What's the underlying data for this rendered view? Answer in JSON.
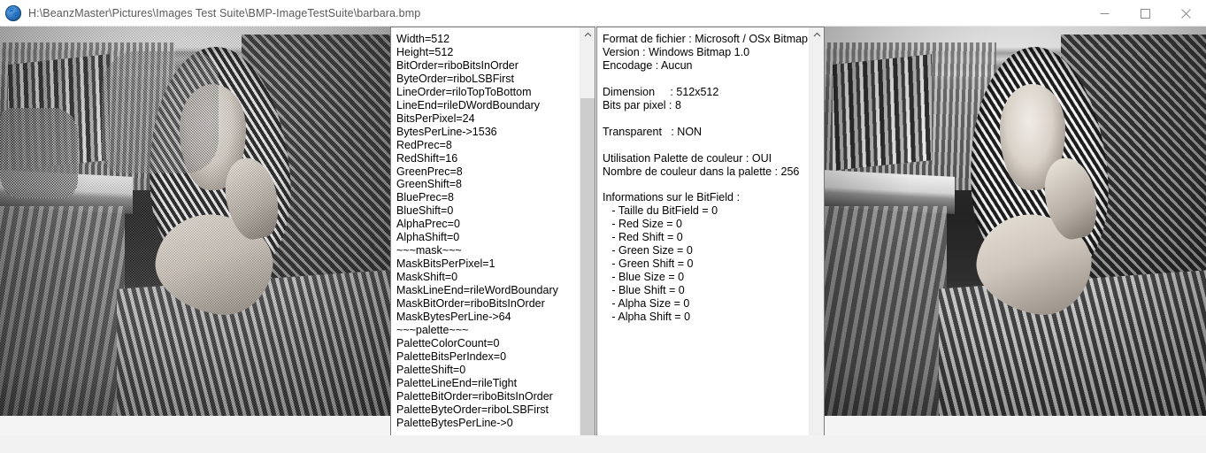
{
  "window": {
    "title": "H:\\BeanzMaster\\Pictures\\Images Test Suite\\BMP-ImageTestSuite\\barbara.bmp",
    "icon": "paw-app-icon",
    "controls": {
      "minimize": "–",
      "maximize": "□",
      "close": "✕"
    }
  },
  "left_image": {
    "alt": "grayscale photograph of a seated woman with patterned headscarf and striped trousers, rendered with heavy dithering artifacts"
  },
  "right_image": {
    "alt": "grayscale photograph of a seated woman with patterned headscarf and striped trousers, clean rendering"
  },
  "panel_left": {
    "name": "raw-image-properties",
    "scroll": {
      "up_arrow": "⌃",
      "down_arrow": "⌄"
    },
    "lines": [
      "Width=512",
      "Height=512",
      "BitOrder=riboBitsInOrder",
      "ByteOrder=riboLSBFirst",
      "LineOrder=riloTopToBottom",
      "LineEnd=rileDWordBoundary",
      "BitsPerPixel=24",
      "BytesPerLine->1536",
      "RedPrec=8",
      "RedShift=16",
      "GreenPrec=8",
      "GreenShift=8",
      "BluePrec=8",
      "BlueShift=0",
      "AlphaPrec=0",
      "AlphaShift=0",
      "~~~mask~~~",
      "MaskBitsPerPixel=1",
      "MaskShift=0",
      "MaskLineEnd=rileWordBoundary",
      "MaskBitOrder=riboBitsInOrder",
      "MaskBytesPerLine->64",
      "~~~palette~~~",
      "PaletteColorCount=0",
      "PaletteBitsPerIndex=0",
      "PaletteShift=0",
      "PaletteLineEnd=rileTight",
      "PaletteBitOrder=riboBitsInOrder",
      "PaletteByteOrder=riboLSBFirst",
      "PaletteBytesPerLine->0"
    ]
  },
  "panel_right": {
    "name": "file-format-summary",
    "scroll": {
      "up_arrow": "⌃",
      "down_arrow": "⌄"
    },
    "lines": [
      "Format de fichier : Microsoft / OSx Bitmap",
      "Version : Windows Bitmap 1.0",
      "Encodage : Aucun",
      "",
      "Dimension     : 512x512",
      "Bits par pixel : 8",
      "",
      "Transparent   : NON",
      "",
      "Utilisation Palette de couleur : OUI",
      "Nombre de couleur dans la palette : 256",
      "",
      "Informations sur le BitField :",
      "   - Taille du BitField = 0",
      "   - Red Size = 0",
      "   - Red Shift = 0",
      "   - Green Size = 0",
      "   - Green Shift = 0",
      "   - Blue Size = 0",
      "   - Blue Shift = 0",
      "   - Alpha Size = 0",
      "   - Alpha Shift = 0"
    ]
  },
  "colors": {
    "titlebar_bg": "#ffffff",
    "title_text": "#5a5a5a",
    "panel_border": "#7a7a7a",
    "scroll_track": "#f0f0f0",
    "scroll_thumb": "#cdcdcd",
    "text": "#000000"
  }
}
